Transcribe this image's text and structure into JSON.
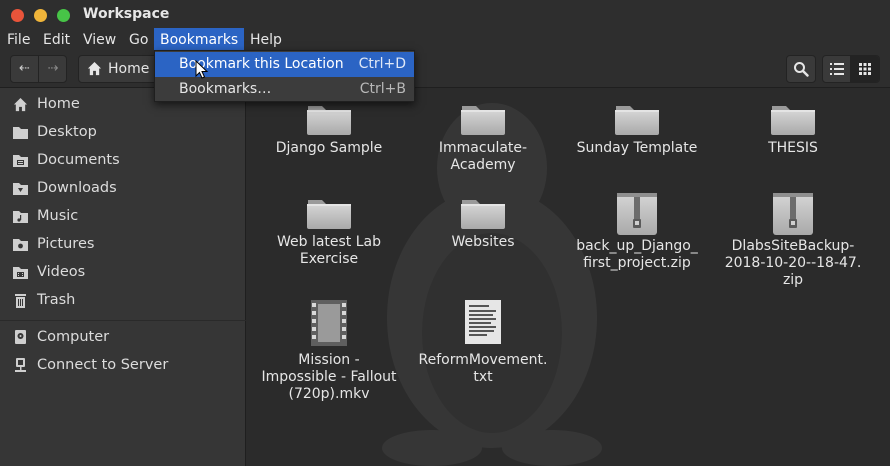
{
  "window": {
    "title": "Workspace"
  },
  "menubar": {
    "items": [
      "File",
      "Edit",
      "View",
      "Go",
      "Bookmarks",
      "Help"
    ],
    "active": "Bookmarks"
  },
  "bookmarks_menu": {
    "items": [
      {
        "label": "Bookmark this Location",
        "shortcut": "Ctrl+D"
      },
      {
        "label": "Bookmarks…",
        "shortcut": "Ctrl+B"
      }
    ]
  },
  "toolbar": {
    "back_icon": "back-arrow-icon",
    "forward_icon": "forward-arrow-icon",
    "path_label": "Home",
    "search_icon": "search-icon",
    "view_modes": [
      "list-view-icon",
      "grid-view-icon"
    ],
    "active_view": "grid"
  },
  "sidebar": {
    "places": [
      {
        "label": "Home",
        "icon": "home-icon"
      },
      {
        "label": "Desktop",
        "icon": "folder-icon"
      },
      {
        "label": "Documents",
        "icon": "documents-folder-icon"
      },
      {
        "label": "Downloads",
        "icon": "downloads-folder-icon"
      },
      {
        "label": "Music",
        "icon": "music-folder-icon"
      },
      {
        "label": "Pictures",
        "icon": "pictures-folder-icon"
      },
      {
        "label": "Videos",
        "icon": "videos-folder-icon"
      },
      {
        "label": "Trash",
        "icon": "trash-icon"
      }
    ],
    "devices": [
      {
        "label": "Computer",
        "icon": "computer-icon"
      },
      {
        "label": "Connect to Server",
        "icon": "server-icon"
      }
    ]
  },
  "files": [
    {
      "line1": "Django Sample",
      "line2": "",
      "line3": "",
      "type": "folder"
    },
    {
      "line1": "Immaculate-",
      "line2": "Academy",
      "line3": "",
      "type": "folder"
    },
    {
      "line1": "Sunday Template",
      "line2": "",
      "line3": "",
      "type": "folder"
    },
    {
      "line1": "THESIS",
      "line2": "",
      "line3": "",
      "type": "folder"
    },
    {
      "line1": "Web latest Lab",
      "line2": "Exercise",
      "line3": "",
      "type": "folder"
    },
    {
      "line1": "Websites",
      "line2": "",
      "line3": "",
      "type": "folder"
    },
    {
      "line1": "back_up_Django_",
      "line2": "first_project.zip",
      "line3": "",
      "type": "zip"
    },
    {
      "line1": "DlabsSiteBackup-",
      "line2": "2018-10-20--18-47.",
      "line3": "zip",
      "type": "zip"
    },
    {
      "line1": "Mission -",
      "line2": "Impossible - Fallout",
      "line3": "(720p).mkv",
      "type": "video"
    },
    {
      "line1": "ReformMovement.",
      "line2": "txt",
      "line3": "",
      "type": "text"
    }
  ],
  "colors": {
    "accent": "#2b64c4",
    "window_bg": "#2b2b2b",
    "sidebar_bg": "#363636",
    "close": "#e9543a",
    "minimize": "#f0b53a",
    "maximize": "#47c447"
  }
}
